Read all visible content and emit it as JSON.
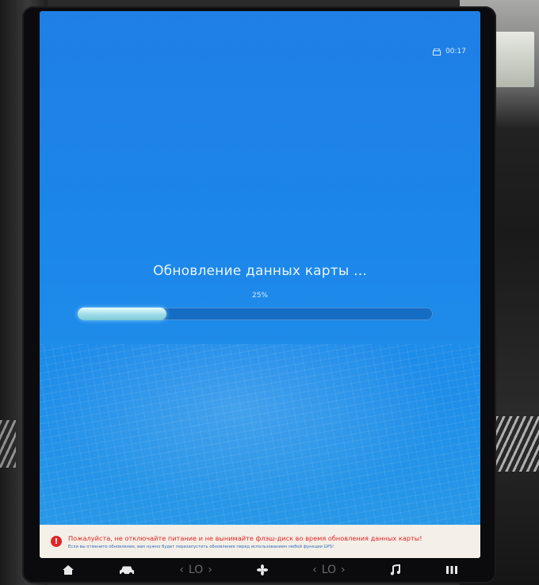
{
  "status_bar": {
    "usb_icon": "usb-drive-icon",
    "time": "00:17"
  },
  "update": {
    "title": "Обновление данных карты ...",
    "percent_label": "25%",
    "progress": 0.25
  },
  "warning": {
    "icon": "exclamation-icon",
    "message": "Пожалуйста, не отключайте питание и не вынимайте флэш-диск во время обновления данных карты!",
    "detail": "Если вы отмените обновление, вам нужно будет перезапустить обновление перед использованием любой функции GPS!"
  },
  "dock": {
    "home_icon": "home-icon",
    "car_icon": "car-icon",
    "left_climate": "LO",
    "fan_icon": "fan-icon",
    "right_climate": "LO",
    "music_icon": "music-note-icon",
    "apps_icon": "apps-icon"
  },
  "colors": {
    "screen": "#1f86e8",
    "warning_text": "#e0262a",
    "warning_subtext": "#2f6fbf"
  }
}
